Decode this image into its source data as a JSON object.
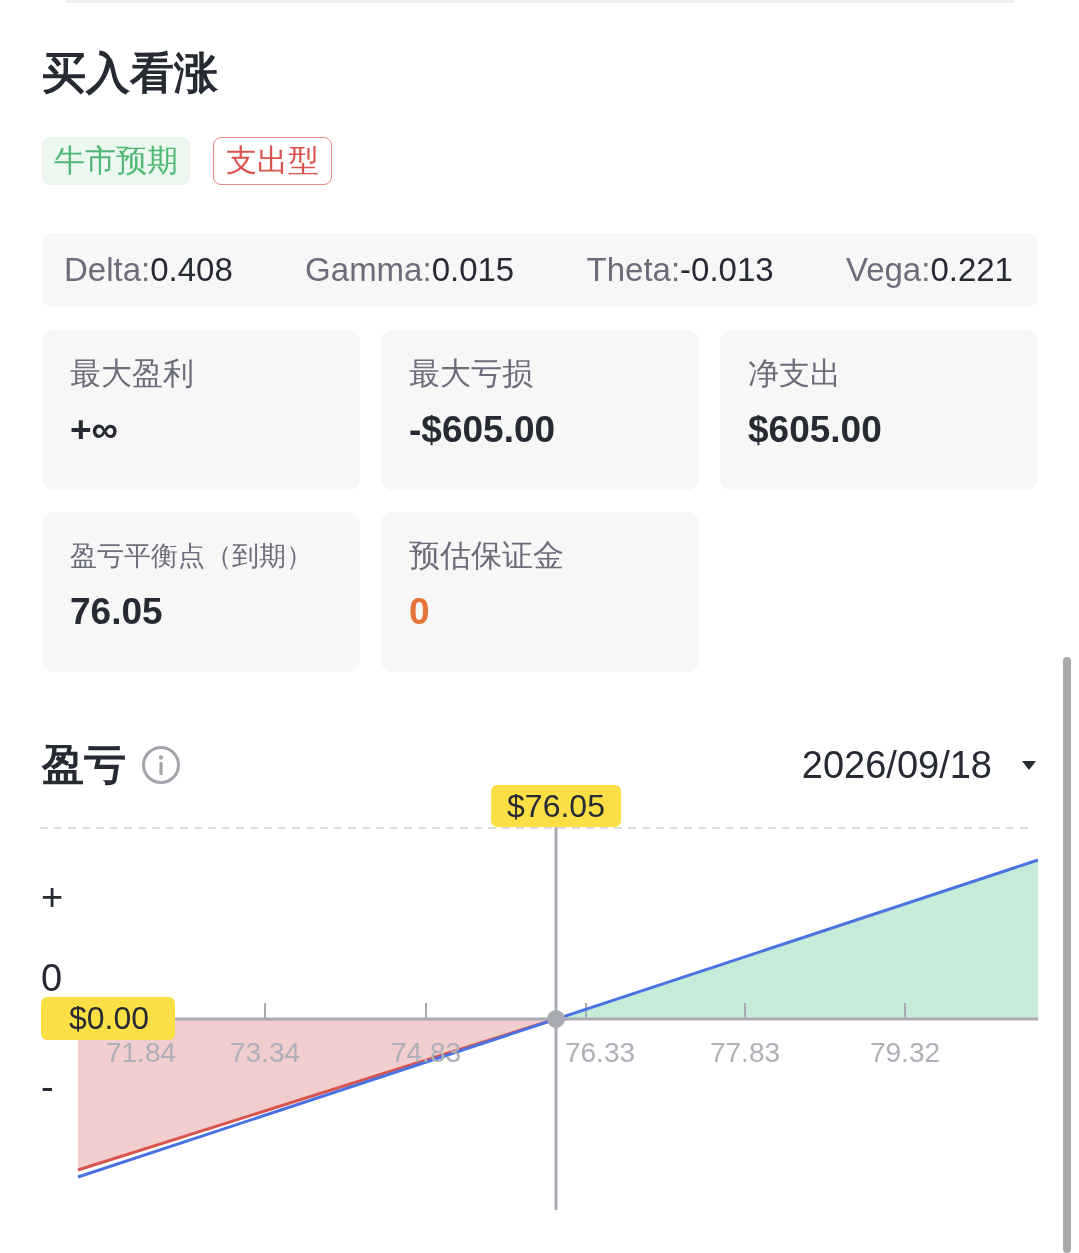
{
  "strategy": {
    "title": "买入看涨",
    "tags": [
      {
        "label": "牛市预期",
        "kind": "filled",
        "color": "#4fb874"
      },
      {
        "label": "支出型",
        "kind": "outlined",
        "color": "#d9534f"
      }
    ]
  },
  "greeks": [
    {
      "name": "Delta:",
      "value": "0.408"
    },
    {
      "name": "Gamma:",
      "value": "0.015"
    },
    {
      "name": "Theta:",
      "value": "-0.013"
    },
    {
      "name": "Vega:",
      "value": "0.221"
    }
  ],
  "metrics": [
    {
      "label": "最大盈利",
      "value": "+∞",
      "color": "#262a33"
    },
    {
      "label": "最大亏损",
      "value": "-$605.00",
      "color": "#262a33"
    },
    {
      "label": "净支出",
      "value": "$605.00",
      "color": "#262a33"
    },
    {
      "label": "盈亏平衡点（到期）",
      "value": "76.05",
      "color": "#262a33"
    },
    {
      "label": "预估保证金",
      "value": "0",
      "color": "#e8733a"
    }
  ],
  "pnl": {
    "title": "盈亏",
    "date": "2026/09/18",
    "chart": {
      "price_marker": "$76.05",
      "zero_marker": "$0.00",
      "y_labels": [
        "+",
        "0",
        "-"
      ],
      "x_labels": [
        "71.84",
        "73.34",
        "74.83",
        "76.33",
        "77.83",
        "79.32"
      ]
    }
  }
}
